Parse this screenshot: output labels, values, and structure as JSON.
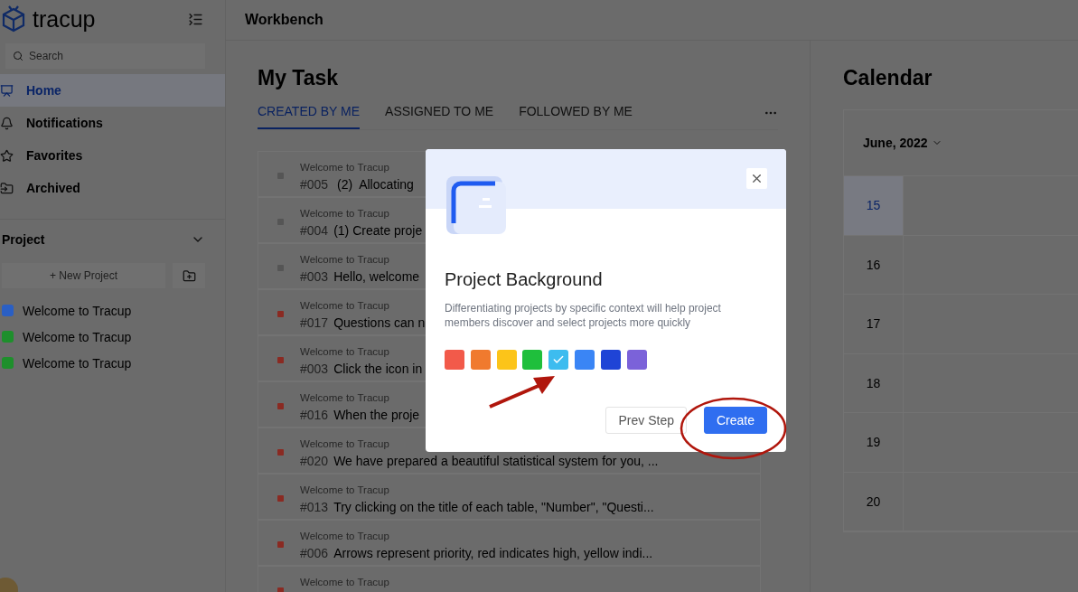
{
  "sidebar": {
    "brand": "tracup",
    "search": {
      "placeholder": "Search"
    },
    "nav": [
      {
        "label": "Home",
        "selected": true
      },
      {
        "label": "Notifications",
        "selected": false
      },
      {
        "label": "Favorites",
        "selected": false
      },
      {
        "label": "Archived",
        "selected": false
      }
    ],
    "project_heading": "Project",
    "new_project": "+ New Project",
    "projects": [
      {
        "name": "Welcome to Tracup",
        "color": "#2a5fc4"
      },
      {
        "name": "Welcome to Tracup",
        "color": "#1e8f2c"
      },
      {
        "name": "Welcome to Tracup",
        "color": "#1e8f2c"
      }
    ]
  },
  "header": {
    "title": "Workbench"
  },
  "my_task": {
    "title": "My Task",
    "tabs": [
      {
        "label": "CREATED BY ME",
        "selected": true
      },
      {
        "label": "ASSIGNED TO ME",
        "selected": false
      },
      {
        "label": "FOLLOWED BY ME",
        "selected": false
      }
    ],
    "tasks": [
      {
        "project": "Welcome to Tracup",
        "number": "#005",
        "title": " (2)  Allocating",
        "color": "#555555"
      },
      {
        "project": "Welcome to Tracup",
        "number": "#004",
        "title": "(1) Create proje",
        "color": "#555555"
      },
      {
        "project": "Welcome to Tracup",
        "number": "#003",
        "title": "Hello, welcome",
        "color": "#555555"
      },
      {
        "project": "Welcome to Tracup",
        "number": "#017",
        "title": "Questions can n",
        "color": "#8a2a22"
      },
      {
        "project": "Welcome to Tracup",
        "number": "#003",
        "title": "Click the icon in",
        "color": "#8a2a22"
      },
      {
        "project": "Welcome to Tracup",
        "number": "#016",
        "title": "When the proje",
        "color": "#8a2a22"
      },
      {
        "project": "Welcome to Tracup",
        "number": "#020",
        "title": "We have prepared a beautiful statistical system for you, ...",
        "color": "#8a2a22"
      },
      {
        "project": "Welcome to Tracup",
        "number": "#013",
        "title": "Try clicking on the title of each table, \"Number\", \"Questi...",
        "color": "#8a2a22"
      },
      {
        "project": "Welcome to Tracup",
        "number": "#006",
        "title": "Arrows represent priority, red indicates high, yellow indi...",
        "color": "#8a2a22"
      },
      {
        "project": "Welcome to Tracup",
        "color": "#8a2a22"
      }
    ]
  },
  "calendar": {
    "title": "Calendar",
    "month": "June, 2022",
    "days": [
      {
        "day": "15",
        "selected": true
      },
      {
        "day": "16",
        "selected": false
      },
      {
        "day": "17",
        "selected": false
      },
      {
        "day": "18",
        "selected": false
      },
      {
        "day": "19",
        "selected": false
      },
      {
        "day": "20",
        "selected": false
      }
    ]
  },
  "dialog": {
    "title": "Project Background",
    "description": "Differentiating projects by specific context will help project members discover and select projects more quickly",
    "swatches": [
      {
        "color": "#f25a4a",
        "selected": false
      },
      {
        "color": "#f07a2e",
        "selected": false
      },
      {
        "color": "#fcc419",
        "selected": false
      },
      {
        "color": "#1fbf3c",
        "selected": false
      },
      {
        "color": "#3dbcef",
        "selected": true
      },
      {
        "color": "#3a85f5",
        "selected": false
      },
      {
        "color": "#1f44d6",
        "selected": false
      },
      {
        "color": "#7b62d9",
        "selected": false
      }
    ],
    "buttons": [
      {
        "label": "Prev Step",
        "kind": "secondary"
      },
      {
        "label": "Create",
        "kind": "primary"
      }
    ]
  }
}
